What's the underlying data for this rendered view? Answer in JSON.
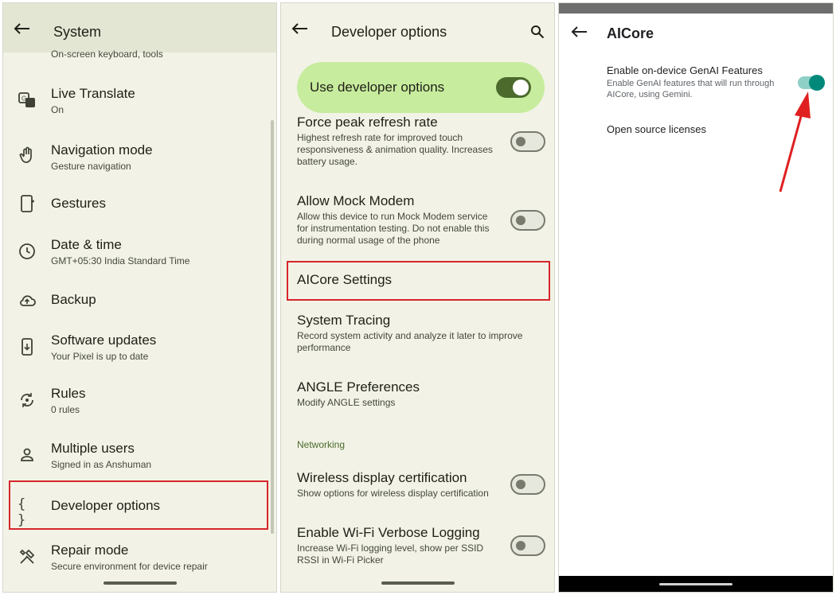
{
  "system_panel": {
    "title": "System",
    "top_subtitle": "On-screen keyboard, tools",
    "items": [
      {
        "label": "Live Translate",
        "sub": "On",
        "icon": "translate-icon"
      },
      {
        "label": "Navigation mode",
        "sub": "Gesture navigation",
        "icon": "gesture-hand-icon"
      },
      {
        "label": "Gestures",
        "sub": "",
        "icon": "phone-gesture-icon"
      },
      {
        "label": "Date & time",
        "sub": "GMT+05:30 India Standard Time",
        "icon": "clock-icon"
      },
      {
        "label": "Backup",
        "sub": "",
        "icon": "cloud-upload-icon"
      },
      {
        "label": "Software updates",
        "sub": "Your Pixel is up to date",
        "icon": "system-update-icon"
      },
      {
        "label": "Rules",
        "sub": "0 rules",
        "icon": "rules-icon"
      },
      {
        "label": "Multiple users",
        "sub": "Signed in as Anshuman",
        "icon": "person-icon"
      },
      {
        "label": "Developer options",
        "sub": "",
        "icon": "braces-icon"
      },
      {
        "label": "Repair mode",
        "sub": "Secure environment for device repair",
        "icon": "tools-icon"
      }
    ]
  },
  "developer_panel": {
    "title": "Developer options",
    "use_developer_options": {
      "label": "Use developer options",
      "enabled": true
    },
    "items": [
      {
        "label": "Force peak refresh rate",
        "sub": "Highest refresh rate for improved touch responsiveness & animation quality. Increases battery usage.",
        "toggle": false
      },
      {
        "label": "Allow Mock Modem",
        "sub": "Allow this device to run Mock Modem service for instrumentation testing. Do not enable this during normal usage of the phone",
        "toggle": false
      },
      {
        "label": "AICore Settings",
        "sub": ""
      },
      {
        "label": "System Tracing",
        "sub": "Record system activity and analyze it later to improve performance"
      },
      {
        "label": "ANGLE Preferences",
        "sub": "Modify ANGLE settings"
      },
      {
        "label": "Wireless display certification",
        "sub": "Show options for wireless display certification",
        "toggle": false
      },
      {
        "label": "Enable Wi-Fi Verbose Logging",
        "sub": "Increase Wi-Fi logging level, show per SSID RSSI in Wi-Fi Picker",
        "toggle": false
      }
    ],
    "section_networking": "Networking"
  },
  "aicore_panel": {
    "title": "AICore",
    "genai_title": "Enable on-device GenAI Features",
    "genai_sub": "Enable GenAI features that will run through AICore, using Gemini.",
    "genai_enabled": true,
    "licenses": "Open source licenses"
  },
  "colors": {
    "highlight": "#d6262b",
    "accent_green": "#4b6a2c",
    "toggle_teal": "#00897b"
  }
}
